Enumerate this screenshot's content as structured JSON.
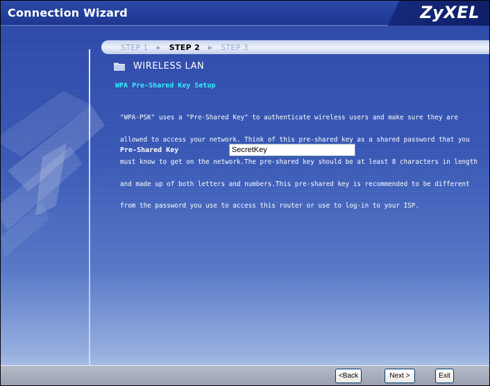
{
  "header": {
    "title": "Connection Wizard",
    "logo": "ZyXEL"
  },
  "steps": [
    {
      "label": "STEP 1",
      "active": false
    },
    {
      "label": "STEP 2",
      "active": true
    },
    {
      "label": "STEP 3",
      "active": false
    }
  ],
  "section": {
    "icon": "folder-icon",
    "title": "WIRELESS LAN"
  },
  "setup": {
    "title": "WPA Pre-Shared Key Setup",
    "description_lines": [
      "\"WPA-PSK\" uses a \"Pre-Shared Key\" to authenticate wireless users and make sure they are",
      "allowed to access your network. Think of this pre-shared key as a shared password that you",
      "must know to get on the network.The pre-shared key should be at least 8 characters in length",
      "and made up of both letters and numbers.This pre-shared key is recommended to be different",
      "from the password you use to access this router or use to log-in to your ISP."
    ],
    "psk_label": "Pre-Shared Key",
    "psk_value": "SecretKey"
  },
  "buttons": {
    "back": "<Back",
    "next": "Next >",
    "exit": "Exit"
  },
  "colors": {
    "background": "#3c5fb8",
    "heading_accent": "#34f0ff",
    "footer": "#a7adbc"
  }
}
